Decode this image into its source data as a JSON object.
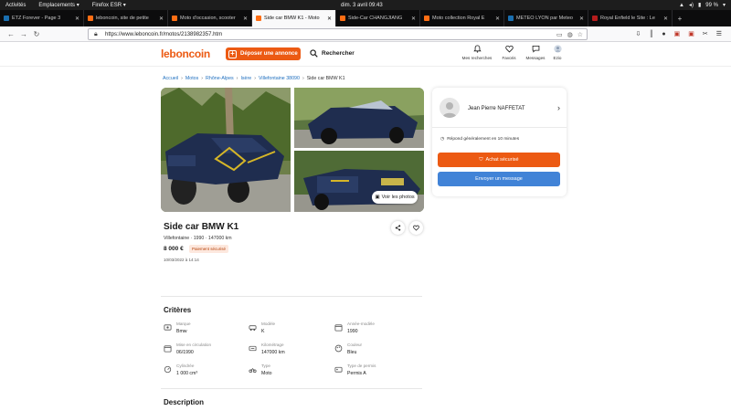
{
  "system_bar": {
    "activities": "Activités",
    "places": "Emplacements ▾",
    "app": "Firefox ESR ▾",
    "clock": "dim. 3 avril 09:43",
    "battery": "99 %"
  },
  "tabs": [
    {
      "title": "ETZ Forever - Page 3"
    },
    {
      "title": "leboncoin, site de petite"
    },
    {
      "title": "Moto d'occasion, scooter"
    },
    {
      "title": "Side car BMW K1 - Moto"
    },
    {
      "title": "Side-Car CHANGJIANG"
    },
    {
      "title": "Moto collection Royal E"
    },
    {
      "title": "METEO LYON par Meteo"
    },
    {
      "title": "Royal Enfield le Site : Le"
    }
  ],
  "browser": {
    "url": "https://www.leboncoin.fr/motos/2138982357.htm"
  },
  "site": {
    "logo": "leboncoin",
    "post_button": "Déposer une annonce",
    "search_link": "Rechercher",
    "nav": [
      {
        "label": "Mes recherches"
      },
      {
        "label": "Favoris"
      },
      {
        "label": "Messages"
      },
      {
        "label": "Ezio"
      }
    ]
  },
  "breadcrumb": [
    "Accueil",
    "Motos",
    "Rhône-Alpes",
    "Isère",
    "Villefontaine 38090",
    "Side car BMW K1"
  ],
  "gallery": {
    "see_photos": "Voir les photos"
  },
  "seller": {
    "name": "Jean Pierre NAFFETAT",
    "response": "Répond généralement en 10 minutes",
    "buy_button": "Achat sécurisé",
    "message_button": "Envoyer un message"
  },
  "listing": {
    "title": "Side car BMW K1",
    "subtitle": "Villefontaine · 1990 · 147000 km",
    "price": "8 000 €",
    "payment_badge": "Paiement sécurisé",
    "posted": "10/03/2022 à 14:14"
  },
  "criteria": {
    "title": "Critères",
    "items": [
      {
        "label": "Marque",
        "value": "Bmw"
      },
      {
        "label": "Modèle",
        "value": "K"
      },
      {
        "label": "Année-modèle",
        "value": "1990"
      },
      {
        "label": "Mise en circulation",
        "value": "06/1990"
      },
      {
        "label": "Kilométrage",
        "value": "147000 km"
      },
      {
        "label": "Couleur",
        "value": "Bleu"
      },
      {
        "label": "Cylindrée",
        "value": "1 000 cm³"
      },
      {
        "label": "Type",
        "value": "Moto"
      },
      {
        "label": "Type de permis",
        "value": "Permis A"
      }
    ]
  },
  "description": {
    "title": "Description"
  },
  "colors": {
    "brand_orange": "#ec5a13",
    "link_blue": "#1f6fbf",
    "message_blue": "#4183d7"
  }
}
